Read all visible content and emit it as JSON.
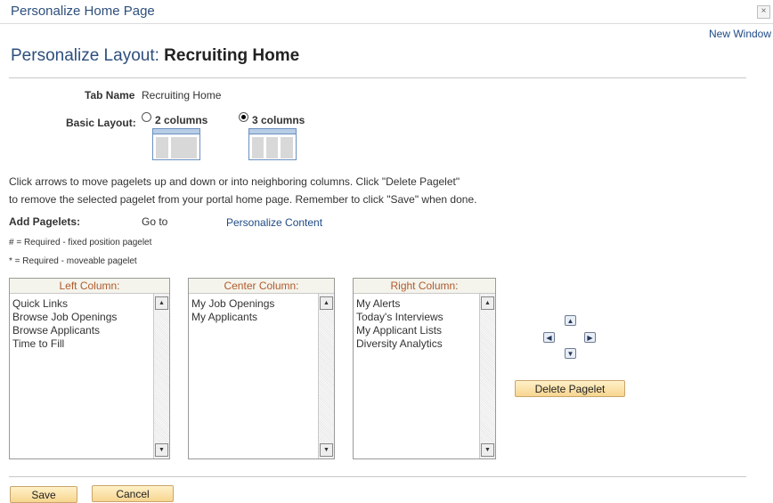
{
  "window": {
    "title": "Personalize Home Page",
    "close_symbol": "×"
  },
  "new_window_link": "New Window",
  "heading": {
    "prefix": "Personalize Layout: ",
    "name": "Recruiting Home"
  },
  "tab_name": {
    "label": "Tab Name",
    "value": "Recruiting Home"
  },
  "basic_layout": {
    "label": "Basic Layout:",
    "options": [
      {
        "label": "2 columns",
        "selected": false
      },
      {
        "label": "3 columns",
        "selected": true
      }
    ]
  },
  "instructions": [
    "Click arrows to move pagelets up and down or into neighboring columns. Click \"Delete Pagelet\"",
    "to remove the selected pagelet from your portal home page. Remember to click \"Save\" when done."
  ],
  "add_pagelets": {
    "label": "Add Pagelets:",
    "goto": "Go to",
    "link": "Personalize Content"
  },
  "notes": [
    "# = Required - fixed position pagelet",
    "* = Required - moveable pagelet"
  ],
  "columns": [
    {
      "header": "Left Column:",
      "items": [
        "Quick Links",
        "Browse Job Openings",
        "Browse Applicants",
        "Time to Fill"
      ]
    },
    {
      "header": "Center Column:",
      "items": [
        "My Job Openings",
        "My Applicants"
      ]
    },
    {
      "header": "Right Column:",
      "items": [
        "My Alerts",
        "Today's Interviews",
        "My Applicant Lists",
        "Diversity Analytics"
      ]
    }
  ],
  "arrows": {
    "up": "▲",
    "down": "▼",
    "left": "◀",
    "right": "▶"
  },
  "scroll_glyphs": {
    "up": "▲",
    "down": "▼"
  },
  "buttons": {
    "delete": "Delete Pagelet",
    "save": "Save",
    "cancel": "Cancel"
  }
}
